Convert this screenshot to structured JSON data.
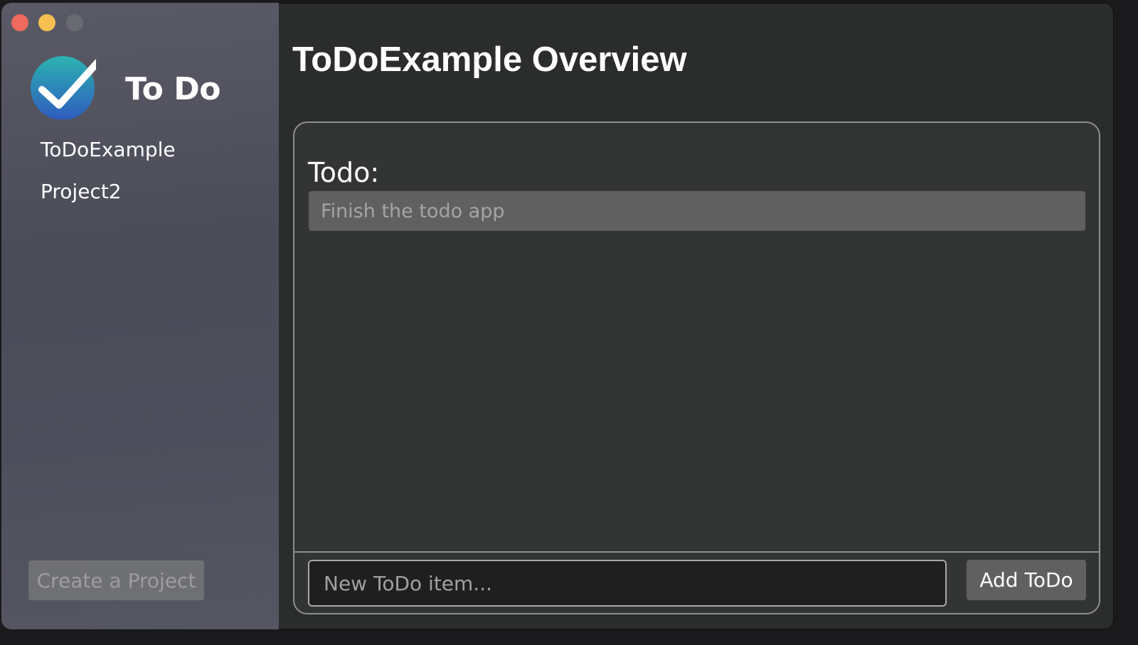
{
  "sidebar": {
    "app_title": "To Do",
    "projects": [
      {
        "label": "ToDoExample"
      },
      {
        "label": "Project2"
      }
    ],
    "create_button_label": "Create a Project"
  },
  "main": {
    "title": "ToDoExample Overview",
    "section_label": "Todo:",
    "todos": [
      {
        "text": "Finish the todo app"
      }
    ],
    "new_item_placeholder": "New ToDo item...",
    "new_item_value": "",
    "add_button_label": "Add ToDo"
  },
  "colors": {
    "close": "#ee6a5e",
    "minimize": "#f5c04f",
    "maximize_disabled": "#6a6b72",
    "logo_gradient_top": "#2bb3b1",
    "logo_gradient_bottom": "#2f5bbf"
  },
  "icons": {
    "logo": "checkmark-circle-icon"
  }
}
